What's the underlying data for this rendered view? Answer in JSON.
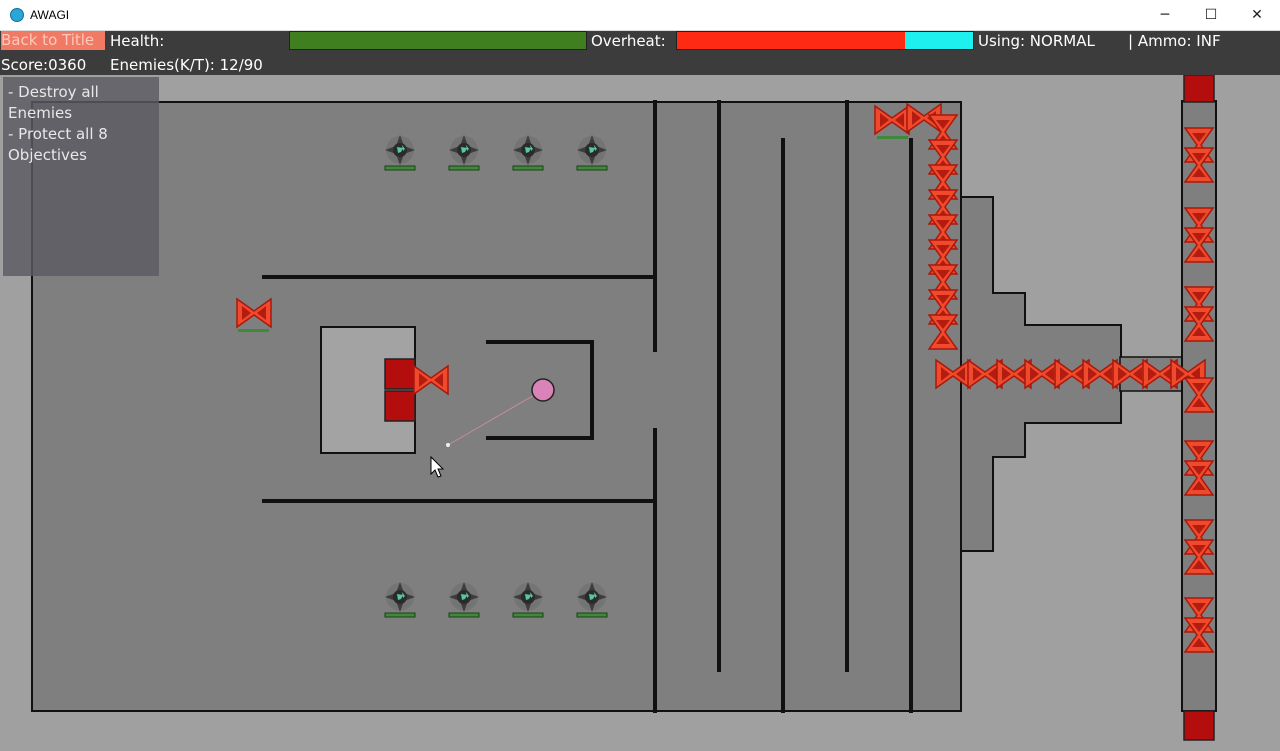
{
  "window": {
    "title": "AWAGI",
    "minimize_glyph": "─",
    "maximize_glyph": "☐",
    "close_glyph": "✕"
  },
  "hud": {
    "back_label": "Back to Title",
    "health_label": "Health:",
    "health_fraction": 1.0,
    "overheat_label": "Overheat:",
    "overheat_fraction": 0.77,
    "using_label": "Using: NORMAL",
    "ammo_label": "| Ammo: INF",
    "score_label": "Score:0360",
    "enemies_label": "Enemies(K/T): 12/90"
  },
  "objectives": {
    "lines": [
      "- Destroy all",
      "Enemies",
      "- Protect all 8",
      "Objectives"
    ]
  },
  "colors": {
    "hud_bg": "#3c3c3c",
    "health_fill": "#3f7f1f",
    "overheat_fill": "#ff2a14",
    "overheat_remaining": "#1ef0f0",
    "enemy": "#f0492b",
    "enemy_dark": "#b31c10",
    "player": "#d983b8",
    "spawner": "#b30d0d"
  },
  "icons": {
    "player": "player-ship-icon",
    "enemy": "enemy-ship-icon",
    "objective": "objective-crystal-icon",
    "cursor": "mouse-cursor-icon"
  }
}
